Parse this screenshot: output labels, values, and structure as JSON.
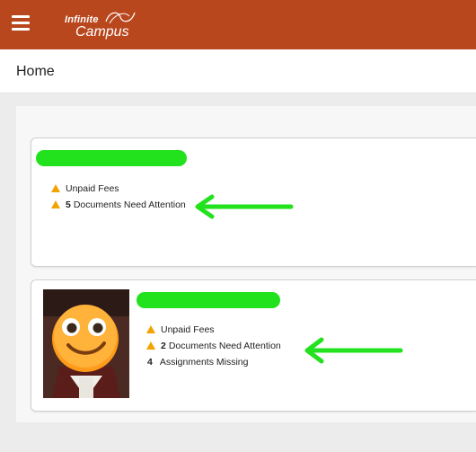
{
  "app": {
    "logo_line1": "Infinite",
    "logo_line2": "Campus"
  },
  "page": {
    "title": "Home"
  },
  "students": [
    {
      "alerts": [
        {
          "icon": "warning-icon",
          "count": "",
          "label": "Unpaid Fees"
        },
        {
          "icon": "warning-icon",
          "count": "5",
          "label": "Documents Need Attention"
        }
      ]
    },
    {
      "alerts": [
        {
          "icon": "warning-icon",
          "count": "",
          "label": "Unpaid Fees"
        },
        {
          "icon": "warning-icon",
          "count": "2",
          "label": "Documents Need Attention"
        },
        {
          "icon": "",
          "count": "4",
          "label": "Assignments Missing"
        }
      ]
    }
  ],
  "colors": {
    "header": "#b9471e",
    "warning": "#f2a300",
    "annotation": "#22e11d"
  }
}
